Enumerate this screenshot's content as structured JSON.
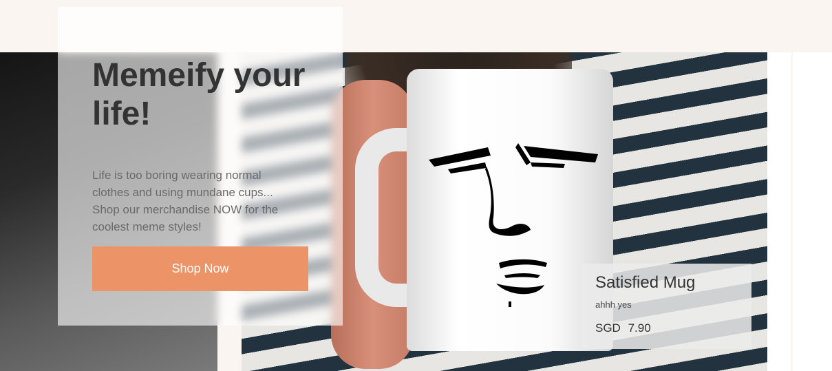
{
  "hero": {
    "title": "Memeify your life!",
    "description": "Life is too boring wearing normal clothes and using mundane cups... Shop our merchandise NOW for the coolest meme styles!",
    "button_label": "Shop Now",
    "button_color": "#ec9468"
  },
  "product": {
    "name": "Satisfied Mug",
    "description": "ahhh yes",
    "currency": "SGD",
    "price": "7.90"
  }
}
